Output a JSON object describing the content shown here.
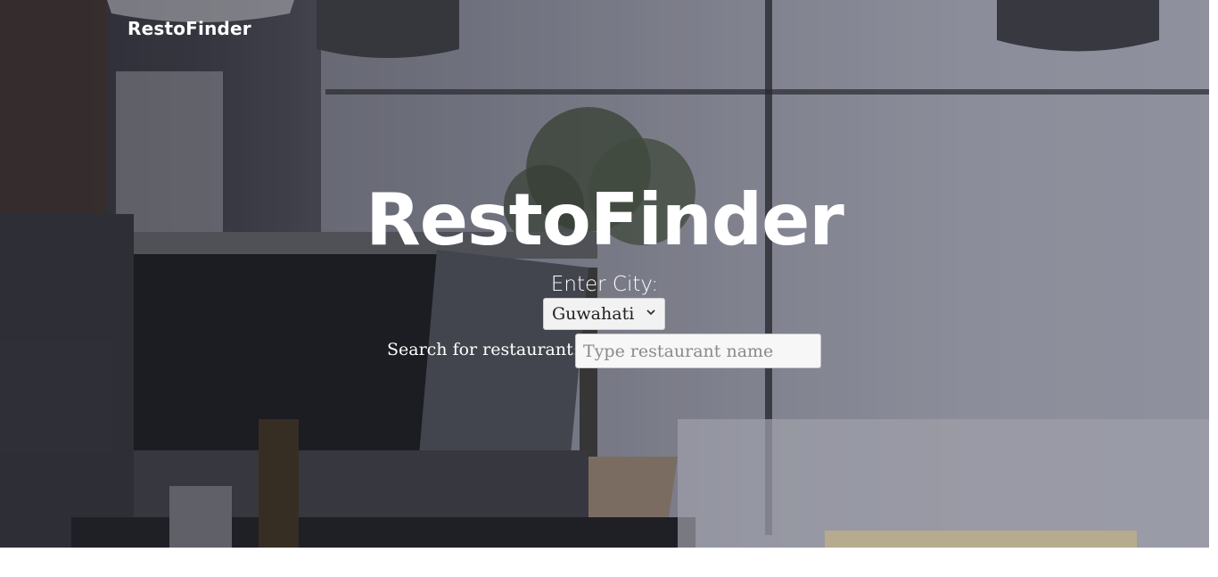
{
  "header": {
    "brand": "RestoFinder"
  },
  "hero": {
    "title": "RestoFinder",
    "city_label": "Enter City:",
    "city_selected": "Guwahati",
    "search_label": "Search for restaurant:",
    "search_placeholder": "Type restaurant name",
    "search_value": ""
  },
  "icons": {
    "select_arrow": "chevron-down-icon"
  },
  "colors": {
    "text": "#ffffff",
    "page_background": "#ffffff"
  }
}
